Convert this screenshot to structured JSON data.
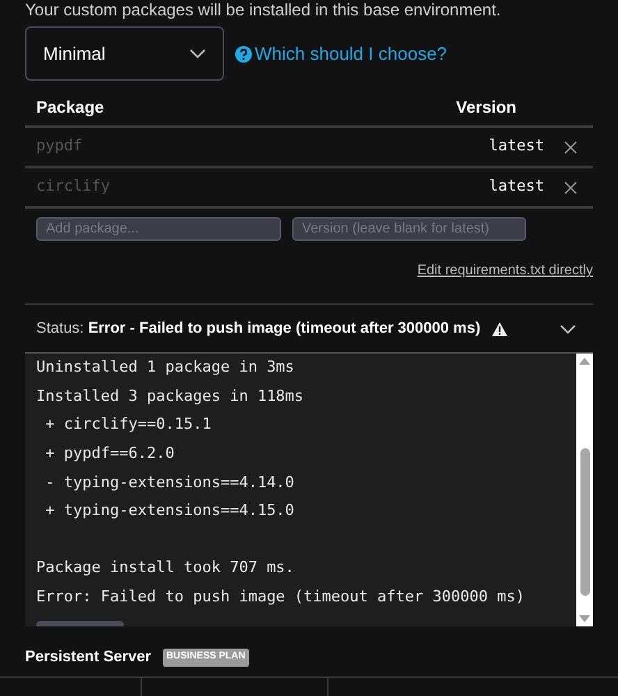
{
  "intro": "Your custom packages will be installed in this base environment.",
  "environment_select": {
    "value": "Minimal"
  },
  "help_link": "Which should I choose?",
  "table": {
    "columns": [
      "Package",
      "Version"
    ],
    "rows": [
      {
        "package": "pypdf",
        "version": "latest"
      },
      {
        "package": "circlify",
        "version": "latest"
      }
    ]
  },
  "add_row": {
    "package_placeholder": "Add package...",
    "version_placeholder": "Version (leave blank for latest)"
  },
  "edit_link": "Edit requirements.txt directly",
  "status": {
    "label": "Status:",
    "value": "Error - Failed to push image (timeout after 300000 ms)",
    "expanded": true
  },
  "log": [
    {
      "text": "Uninstalled 1 package in 3ms",
      "space_before": false
    },
    {
      "text": "Installed 3 packages in 118ms",
      "space_before": false
    },
    {
      "text": " + circlify==0.15.1",
      "space_before": false
    },
    {
      "text": " + pypdf==6.2.0",
      "space_before": false
    },
    {
      "text": " - typing-extensions==4.14.0",
      "space_before": false
    },
    {
      "text": " + typing-extensions==4.15.0",
      "space_before": false
    },
    {
      "text": "Package install took 707 ms.",
      "space_before": true
    },
    {
      "text": "Error: Failed to push image (timeout after 300000 ms)",
      "space_before": false
    }
  ],
  "persistent_server": {
    "label": "Persistent Server",
    "badge": "BUSINESS PLAN"
  }
}
